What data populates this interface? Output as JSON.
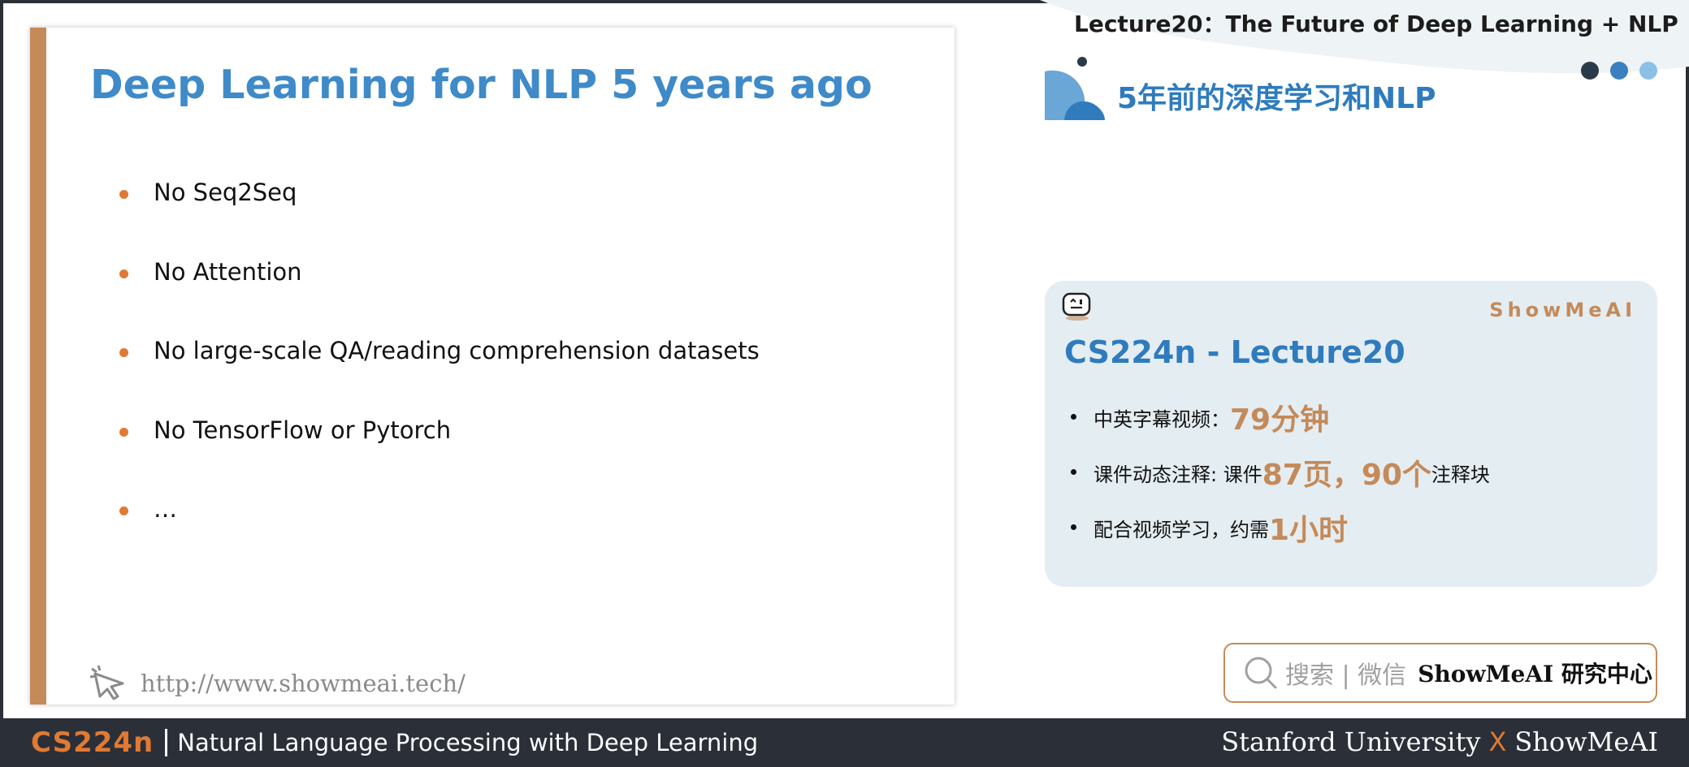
{
  "slide": {
    "title": "Deep Learning for NLP 5 years ago",
    "bullets": [
      "No Seq2Seq",
      "No Attention",
      "No large-scale QA/reading comprehension datasets",
      "No TensorFlow or Pytorch",
      "…"
    ],
    "url": "http://www.showmeai.tech/"
  },
  "header": {
    "lecture_title": "Lecture20：The Future of Deep Learning + NLP",
    "section_title": "5年前的深度学习和NLP"
  },
  "info_card": {
    "brand": "ShowMeAI",
    "title": "CS224n - Lecture20",
    "items": [
      {
        "text": "中英字幕视频：",
        "highlight": "79分钟",
        "suffix": ""
      },
      {
        "text": "课件动态注释: 课件",
        "highlight": "87页，90个",
        "suffix": "注释块"
      },
      {
        "text": "配合视频学习，约需",
        "highlight": "1小时",
        "suffix": ""
      }
    ]
  },
  "search": {
    "label": "搜索 | 微信",
    "term": "ShowMeAI 研究中心"
  },
  "footer": {
    "course_code": "CS224n",
    "course_name": "Natural Language Processing with Deep Learning",
    "left_org": "Stanford University",
    "separator": "X",
    "right_org": "ShowMeAI"
  },
  "colors": {
    "accent_orange": "#e07a32",
    "accent_brown": "#c48a5a",
    "title_blue": "#3f8ac8",
    "card_bg": "#e4edf1",
    "footer_bg": "#2a2f38"
  },
  "icons": [
    "cursor-click-icon",
    "robot-icon",
    "search-icon",
    "section-logo-icon"
  ]
}
